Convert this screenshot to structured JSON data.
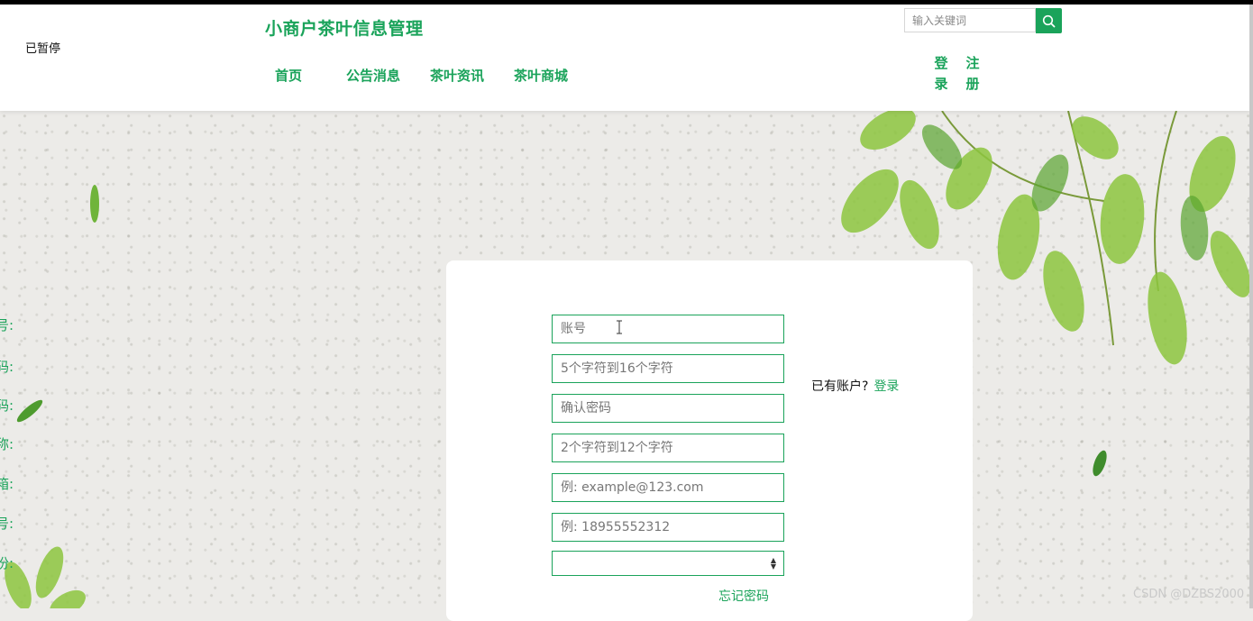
{
  "status": {
    "paused_label": "已暂停"
  },
  "header": {
    "site_title": "小商户茶叶信息管理",
    "nav": [
      {
        "label": "首页"
      },
      {
        "label": "公告消息"
      },
      {
        "label": "茶叶资讯"
      },
      {
        "label": "茶叶商城"
      }
    ],
    "search": {
      "placeholder": "输入关键词",
      "icon": "search-icon"
    },
    "auth": {
      "login": "登录",
      "register": "注册"
    }
  },
  "form": {
    "fields": [
      {
        "label": "账号:",
        "placeholder": "账号"
      },
      {
        "label": "设置密码:",
        "placeholder": "5个字符到16个字符"
      },
      {
        "label": "确认密码:",
        "placeholder": "确认密码"
      },
      {
        "label": "昵称:",
        "placeholder": "2个字符到12个字符"
      },
      {
        "label": "邮箱:",
        "placeholder": "例: example@123.com"
      },
      {
        "label": "手机号:",
        "placeholder": "例: 18955552312"
      }
    ],
    "identity": {
      "label": "身份:",
      "selected": ""
    },
    "have_account_text": "已有账户?",
    "login_link": "登录",
    "forgot_password": "忘记密码"
  },
  "watermark": "CSDN @DZBS2000",
  "colors": {
    "accent": "#1aa35a",
    "header_bg": "#ffffff",
    "page_bg": "#ecebe8"
  }
}
